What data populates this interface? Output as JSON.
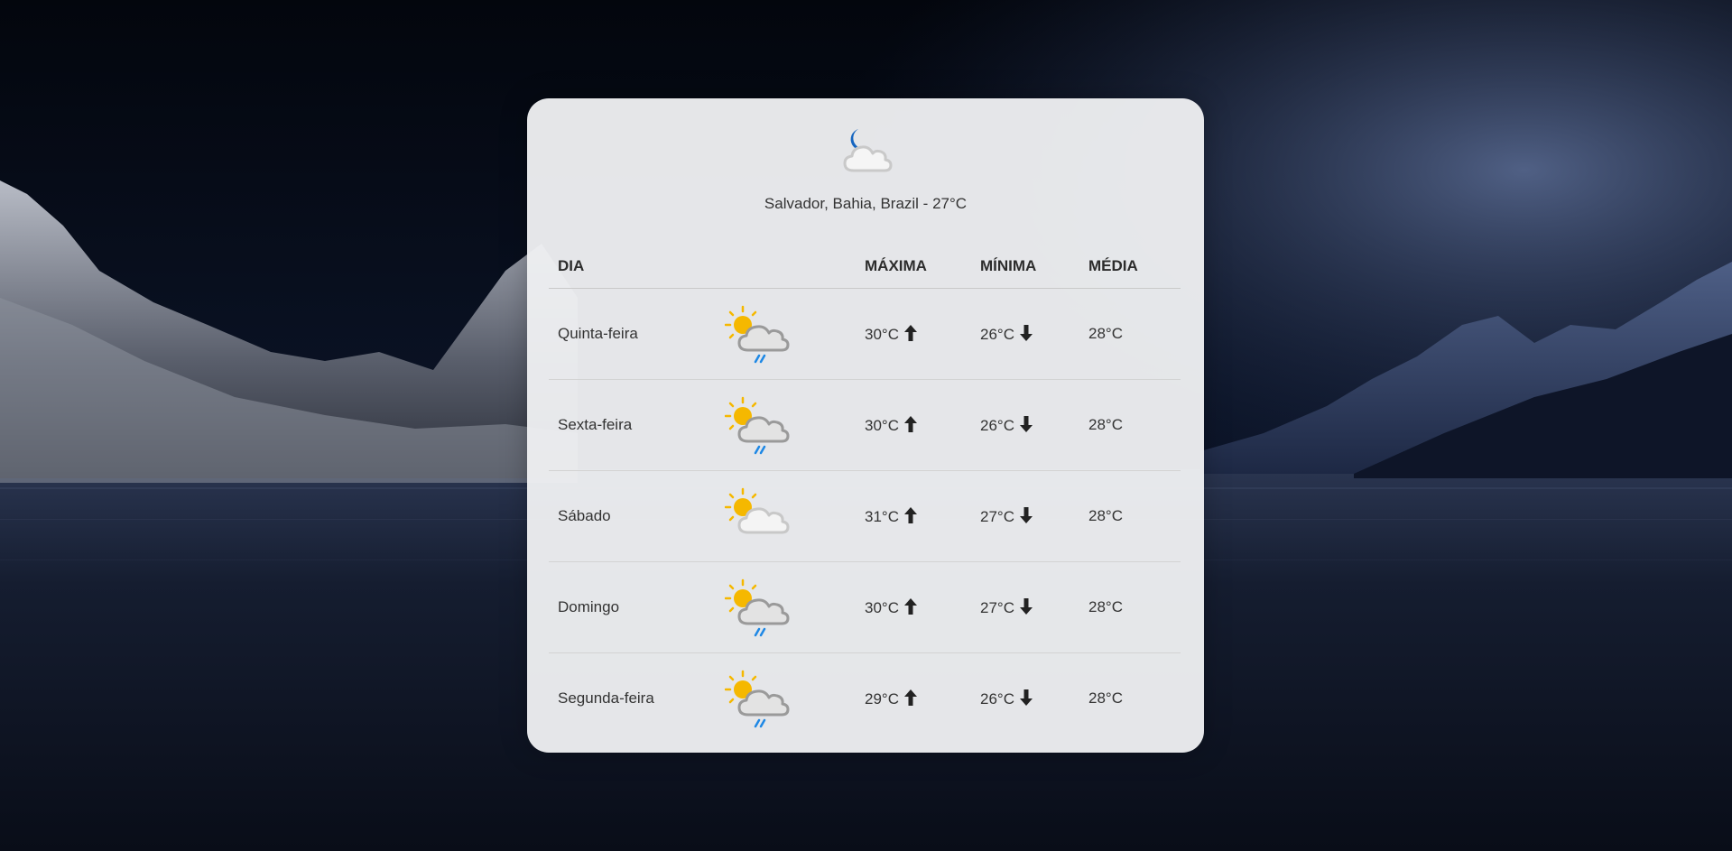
{
  "current": {
    "icon": "moon-cloud-icon",
    "location_text": "Salvador, Bahia, Brazil - 27°C"
  },
  "table": {
    "headers": {
      "day": "DIA",
      "max": "MÁXIMA",
      "min": "MÍNIMA",
      "avg": "MÉDIA"
    },
    "rows": [
      {
        "day": "Quinta-feira",
        "icon": "sun-cloud-rain-icon",
        "max": "30°C",
        "min": "26°C",
        "avg": "28°C"
      },
      {
        "day": "Sexta-feira",
        "icon": "sun-cloud-rain-icon",
        "max": "30°C",
        "min": "26°C",
        "avg": "28°C"
      },
      {
        "day": "Sábado",
        "icon": "sun-cloud-icon",
        "max": "31°C",
        "min": "27°C",
        "avg": "28°C"
      },
      {
        "day": "Domingo",
        "icon": "sun-cloud-rain-icon",
        "max": "30°C",
        "min": "27°C",
        "avg": "28°C"
      },
      {
        "day": "Segunda-feira",
        "icon": "sun-cloud-rain-icon",
        "max": "29°C",
        "min": "26°C",
        "avg": "28°C"
      }
    ]
  },
  "colors": {
    "moon": "#1565c0",
    "sun": "#f5b800",
    "cloud_dark": "#9a9a9a",
    "cloud_light": "#c8c8c8",
    "rain": "#1e88e5"
  }
}
